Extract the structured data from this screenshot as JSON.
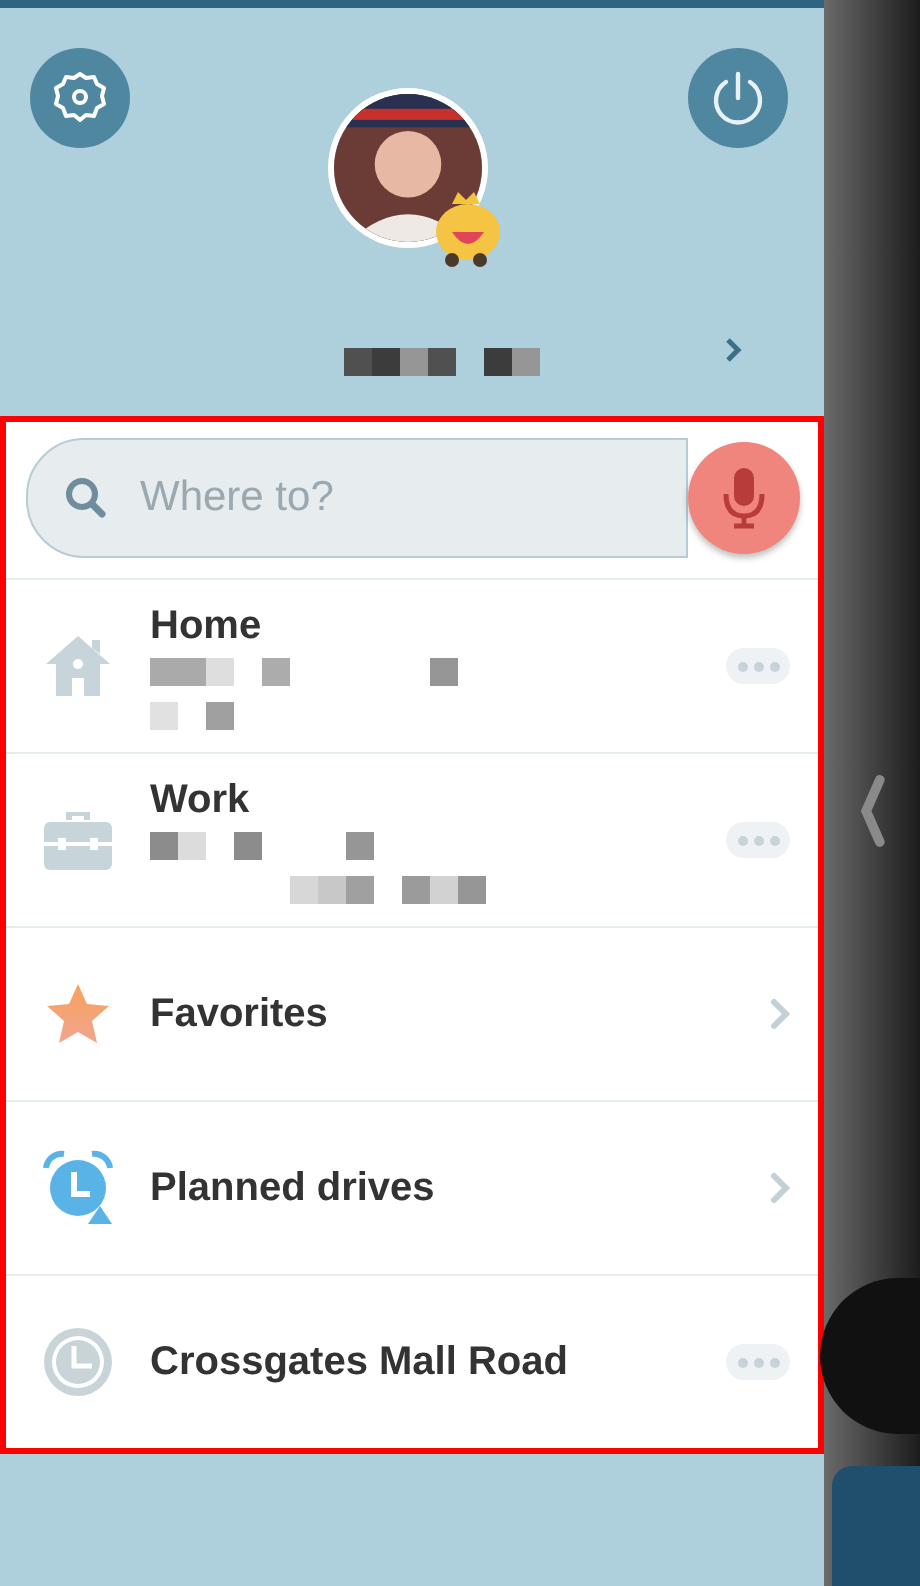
{
  "header": {
    "name_redacted": true
  },
  "search": {
    "placeholder": "Where to?"
  },
  "menu": [
    {
      "kind": "home",
      "label": "Home",
      "details_redacted": true
    },
    {
      "kind": "work",
      "label": "Work",
      "details_redacted": true
    },
    {
      "kind": "favorites",
      "label": "Favorites"
    },
    {
      "kind": "planned",
      "label": "Planned drives"
    },
    {
      "kind": "recent",
      "label": "Crossgates Mall Road"
    }
  ]
}
